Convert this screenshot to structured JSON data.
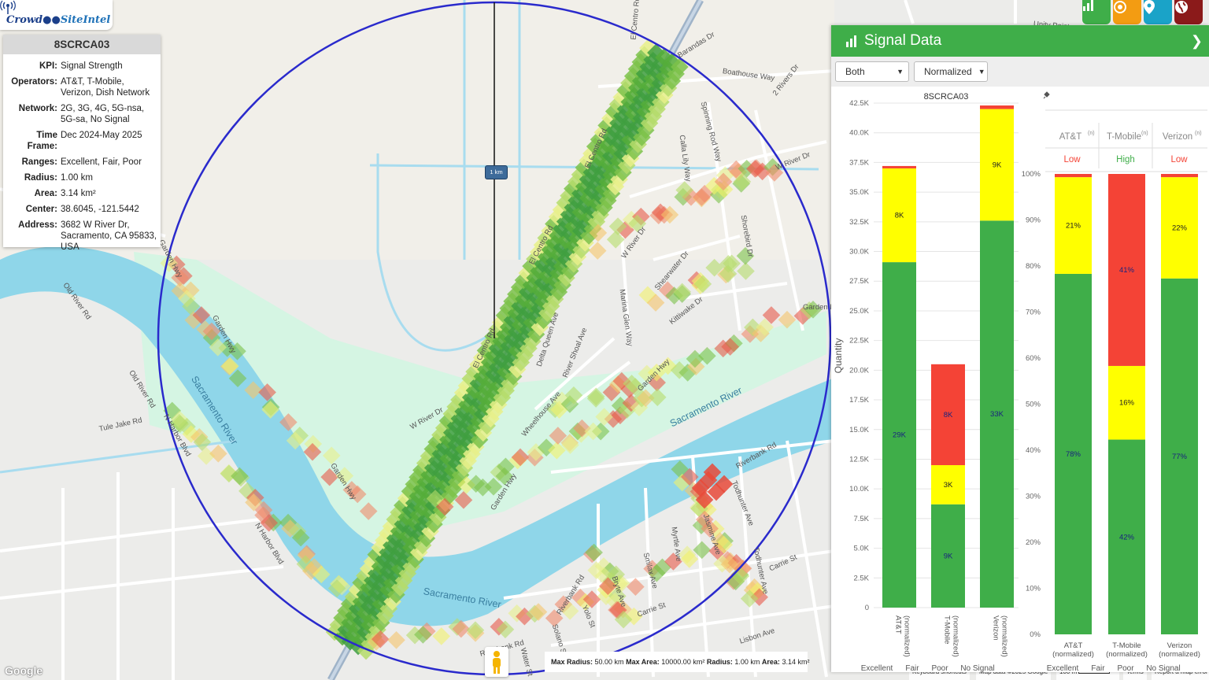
{
  "logo": {
    "crowd": "Crowd",
    "site_intel": "SiteIntel"
  },
  "info_panel": {
    "title": "8SCRCA03",
    "rows": [
      {
        "label": "KPI:",
        "value": "Signal Strength"
      },
      {
        "label": "Operators:",
        "value": "AT&T, T-Mobile, Verizon, Dish Network"
      },
      {
        "label": "Network:",
        "value": "2G, 3G, 4G, 5G-nsa, 5G-sa, No Signal"
      },
      {
        "label": "Time Frame:",
        "value": "Dec 2024-May 2025"
      },
      {
        "label": "Ranges:",
        "value": "Excellent, Fair, Poor"
      },
      {
        "label": "Radius:",
        "value": "1.00 km"
      },
      {
        "label": "Area:",
        "value": "3.14 km²"
      },
      {
        "label": "Center:",
        "value": "38.6045, -121.5442"
      },
      {
        "label": "Address:",
        "value": "3682 W River Dr, Sacramento, CA 95833, USA"
      }
    ]
  },
  "map": {
    "scale_label": "1 km",
    "streets": [
      "Barandas Dr",
      "Boathouse Way",
      "2 Rivers Dr",
      "Spinning Rod Way",
      "Calla Lily Way",
      "W River Dr",
      "W River Dr",
      "Shorebird Dr",
      "Shearwater Dr",
      "Kittiwake Dr",
      "El Centro Rd",
      "El Centro Rd",
      "El Centro Rd",
      "El Centro Rd",
      "Marina Glen Way",
      "River Shoal Ave",
      "Delta Queen Ave",
      "Wheelhouse Ave",
      "Garden Hwy",
      "Garden Hwy",
      "Garden Hwy",
      "Garden Hwy",
      "Garden Hwy",
      "Old River Rd",
      "Old River Rd",
      "Tule Jake Rd",
      "N Harbor Blvd",
      "N Harbor Blvd",
      "Riverbank Rd",
      "Riverbank Rd",
      "Riverbank Rd",
      "Todhunter Ave",
      "Todhunter Ave",
      "Carrie St",
      "Carrie St",
      "Lisbon Ave",
      "Myrtle Ave",
      "Jasmine Ave",
      "Smilax Ave",
      "Bryte Ave",
      "Yolo St",
      "Solano St",
      "Water St",
      "Unity Pointe",
      "W River Dr",
      "Garden Hwy"
    ],
    "rivers": [
      "Sacramento River",
      "Sacramento River",
      "Sacramento River"
    ],
    "bottom_stats": {
      "max_radius_label": "Max Radius:",
      "max_radius": "50.00 km",
      "max_area_label": "Max Area:",
      "max_area": "10000.00 km²",
      "radius_label": "Radius:",
      "radius": "1.00 km",
      "area_label": "Area:",
      "area": "3.14 km²"
    },
    "google": "Google",
    "attribution": {
      "shortcuts": "Keyboard shortcuts",
      "map_data": "Map data ©2025 Google",
      "scale": "100 m",
      "terms": "Terms",
      "report": "Report a map error"
    },
    "buttons": [
      {
        "name": "chart-icon",
        "color": "#3fae49"
      },
      {
        "name": "target-icon",
        "color": "#f39c12"
      },
      {
        "name": "location-pin-icon",
        "color": "#1aa3c8"
      },
      {
        "name": "globe-icon",
        "color": "#8b1a1a"
      }
    ]
  },
  "signal_panel": {
    "title": "Signal Data",
    "select_mode": "Both",
    "select_scale": "Normalized"
  },
  "colors": {
    "excellent": "#3fae49",
    "fair": "#ffff00",
    "poor": "#f44336",
    "no_signal": "#bdbdbd",
    "accent": "#3fae49",
    "circle": "#2a2acc"
  },
  "chart_data": [
    {
      "type": "bar",
      "title": "8SCRCA03",
      "ylabel": "Quantity",
      "ylim": [
        0,
        42500
      ],
      "yticks": [
        "0",
        "2.5K",
        "5.0K",
        "7.5K",
        "10.0K",
        "12.5K",
        "15.0K",
        "17.5K",
        "20.0K",
        "22.5K",
        "25.0K",
        "27.5K",
        "30.0K",
        "32.5K",
        "35.0K",
        "37.5K",
        "40.0K",
        "42.5K"
      ],
      "categories": [
        "AT&T (normalized)",
        "T-Mobile (normalized)",
        "Verizon (normalized)"
      ],
      "series": [
        {
          "name": "Excellent",
          "values": [
            29100,
            8700,
            32600
          ],
          "labels": [
            "29K",
            "9K",
            "33K"
          ]
        },
        {
          "name": "Fair",
          "values": [
            7900,
            3300,
            9400
          ],
          "labels": [
            "8K",
            "3K",
            "9K"
          ]
        },
        {
          "name": "Poor",
          "values": [
            200,
            8500,
            300
          ],
          "labels": [
            "",
            "8K",
            ""
          ]
        },
        {
          "name": "No Signal",
          "values": [
            0,
            0,
            0
          ],
          "labels": [
            "",
            "",
            ""
          ]
        }
      ],
      "legend": [
        "Excellent",
        "Fair",
        "Poor",
        "No Signal"
      ]
    },
    {
      "type": "bar",
      "ylim": [
        0,
        100
      ],
      "yticks": [
        "0%",
        "10%",
        "20%",
        "30%",
        "40%",
        "50%",
        "60%",
        "70%",
        "80%",
        "90%",
        "100%"
      ],
      "operators": [
        {
          "name": "AT&T",
          "sup": "(n)",
          "rating": "Low",
          "rating_color": "#f44336"
        },
        {
          "name": "T-Mobile",
          "sup": "(n)",
          "rating": "High",
          "rating_color": "#3fae49"
        },
        {
          "name": "Verizon",
          "sup": "(n)",
          "rating": "Low",
          "rating_color": "#f44336"
        }
      ],
      "categories": [
        "AT&T (normalized)",
        "T-Mobile (normalized)",
        "Verizon (normalized)"
      ],
      "series": [
        {
          "name": "Excellent",
          "values": [
            78.3,
            42.3,
            77.3
          ],
          "labels": [
            "78%",
            "42%",
            "77%"
          ]
        },
        {
          "name": "Fair",
          "values": [
            21.0,
            16.0,
            22.0
          ],
          "labels": [
            "21%",
            "16%",
            "22%"
          ]
        },
        {
          "name": "Poor",
          "values": [
            0.7,
            41.7,
            0.7
          ],
          "labels": [
            "",
            "41%",
            ""
          ]
        },
        {
          "name": "No Signal",
          "values": [
            0,
            0,
            0
          ],
          "labels": [
            "",
            "",
            ""
          ]
        }
      ],
      "legend": [
        "Excellent",
        "Fair",
        "Poor",
        "No Signal"
      ]
    }
  ]
}
